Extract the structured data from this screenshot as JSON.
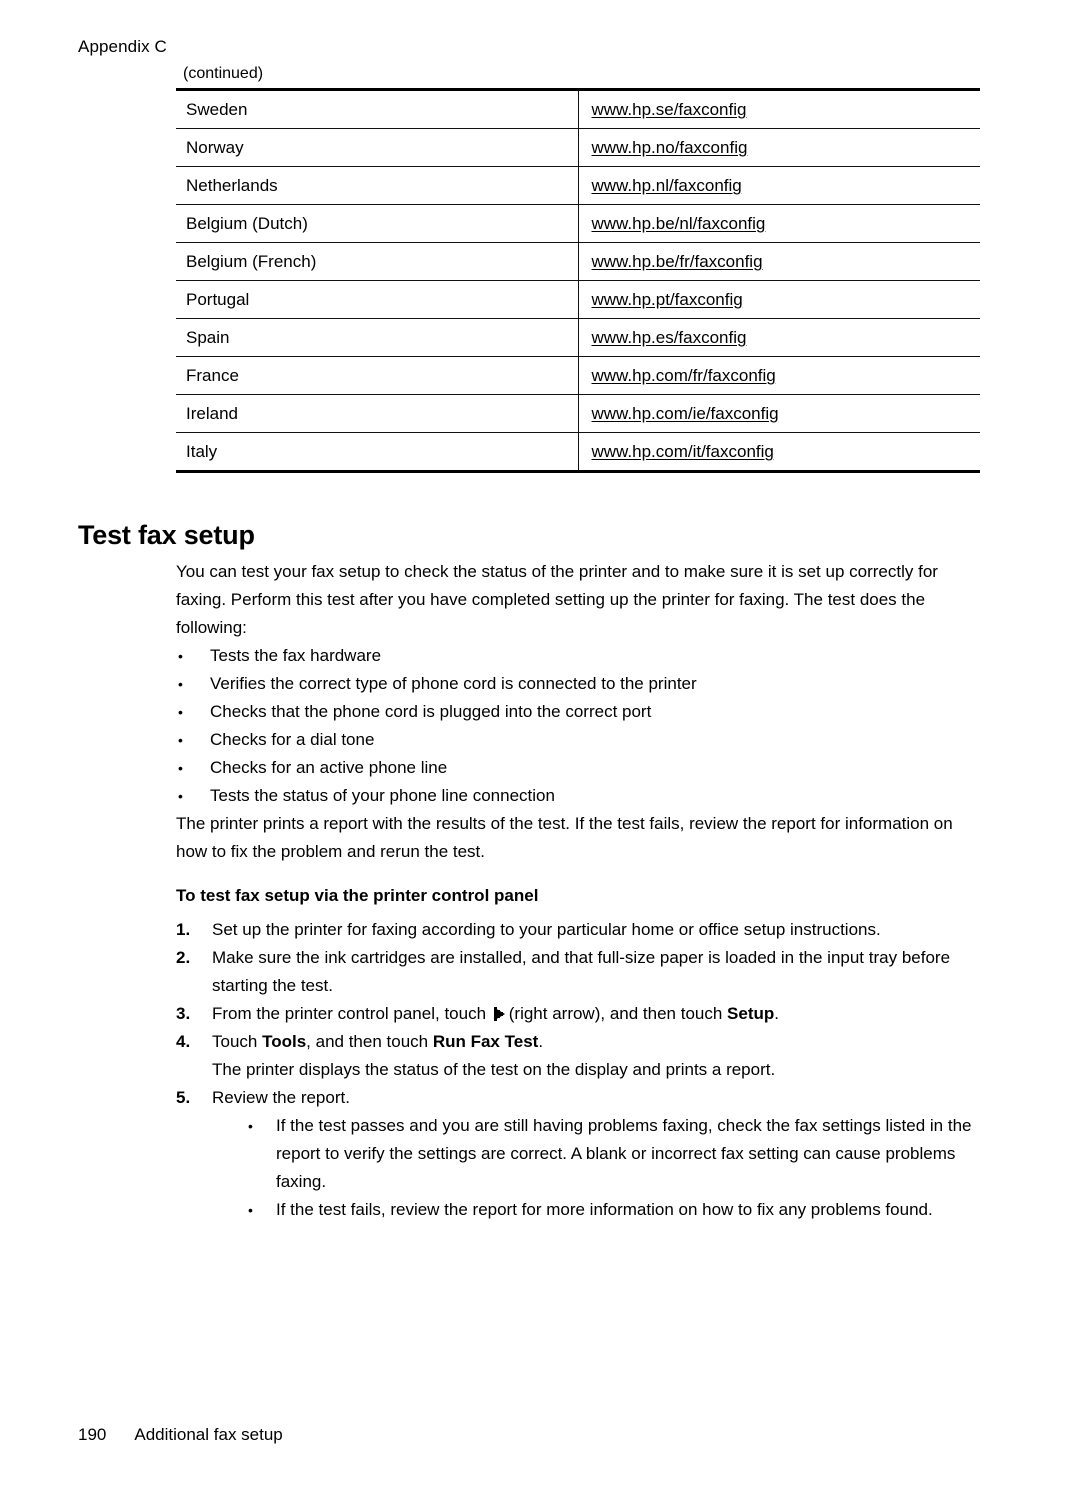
{
  "header": {
    "running_head": "Appendix C",
    "continued_label": "(continued)"
  },
  "table": {
    "rows": [
      {
        "country": "Sweden",
        "url": "www.hp.se/faxconfig"
      },
      {
        "country": "Norway",
        "url": "www.hp.no/faxconfig"
      },
      {
        "country": "Netherlands",
        "url": "www.hp.nl/faxconfig"
      },
      {
        "country": "Belgium (Dutch)",
        "url": "www.hp.be/nl/faxconfig"
      },
      {
        "country": "Belgium (French)",
        "url": "www.hp.be/fr/faxconfig"
      },
      {
        "country": "Portugal",
        "url": "www.hp.pt/faxconfig"
      },
      {
        "country": "Spain",
        "url": "www.hp.es/faxconfig"
      },
      {
        "country": "France",
        "url": "www.hp.com/fr/faxconfig"
      },
      {
        "country": "Ireland",
        "url": "www.hp.com/ie/faxconfig"
      },
      {
        "country": "Italy",
        "url": "www.hp.com/it/faxconfig"
      }
    ]
  },
  "section": {
    "heading": "Test fax setup",
    "intro": "You can test your fax setup to check the status of the printer and to make sure it is set up correctly for faxing. Perform this test after you have completed setting up the printer for faxing. The test does the following:",
    "bullets": [
      "Tests the fax hardware",
      "Verifies the correct type of phone cord is connected to the printer",
      "Checks that the phone cord is plugged into the correct port",
      "Checks for a dial tone",
      "Checks for an active phone line",
      "Tests the status of your phone line connection"
    ],
    "after_bullets": "The printer prints a report with the results of the test. If the test fails, review the report for information on how to fix the problem and rerun the test.",
    "procedure_heading": "To test fax setup via the printer control panel",
    "steps": [
      {
        "num": "1.",
        "text": "Set up the printer for faxing according to your particular home or office setup instructions."
      },
      {
        "num": "2.",
        "text": "Make sure the ink cartridges are installed, and that full-size paper is loaded in the input tray before starting the test."
      },
      {
        "num": "3.",
        "text_before": "From the printer control panel, touch ",
        "icon": "right-arrow-icon",
        "text_mid": "(right arrow), and then touch ",
        "bold": "Setup",
        "text_after": "."
      },
      {
        "num": "4.",
        "text_before": "Touch ",
        "bold1": "Tools",
        "text_mid": ", and then touch ",
        "bold2": "Run Fax Test",
        "text_after": ".",
        "note": "The printer displays the status of the test on the display and prints a report."
      },
      {
        "num": "5.",
        "text": "Review the report.",
        "sub_bullets": [
          "If the test passes and you are still having problems faxing, check the fax settings listed in the report to verify the settings are correct. A blank or incorrect fax setting can cause problems faxing.",
          "If the test fails, review the report for more information on how to fix any problems found."
        ]
      }
    ]
  },
  "footer": {
    "page_number": "190",
    "section_name": "Additional fax setup"
  },
  "colors": {
    "text": "#000000",
    "background": "#ffffff",
    "rule": "#111111"
  }
}
